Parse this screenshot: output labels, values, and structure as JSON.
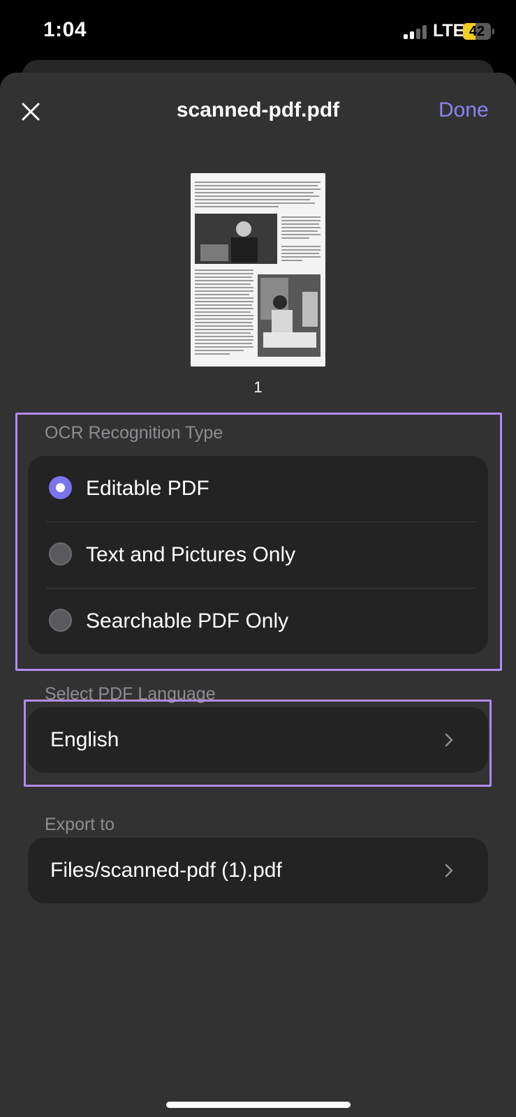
{
  "status_bar": {
    "time": "1:04",
    "network": "LTE",
    "battery": "42"
  },
  "header": {
    "title": "scanned-pdf.pdf",
    "done_label": "Done",
    "close_icon": "close-icon"
  },
  "preview": {
    "page_number": "1"
  },
  "ocr": {
    "section_label": "OCR Recognition Type",
    "options": [
      {
        "label": "Editable PDF",
        "selected": true
      },
      {
        "label": "Text and Pictures Only",
        "selected": false
      },
      {
        "label": "Searchable PDF Only",
        "selected": false
      }
    ]
  },
  "language": {
    "section_label": "Select PDF Language",
    "value": "English"
  },
  "export": {
    "section_label": "Export to",
    "value": "Files/scanned-pdf (1).pdf"
  },
  "colors": {
    "accent": "#7c73ee",
    "done": "#8a84f0",
    "highlight": "#b08cf0",
    "sheet": "#323233",
    "card": "#232323"
  }
}
